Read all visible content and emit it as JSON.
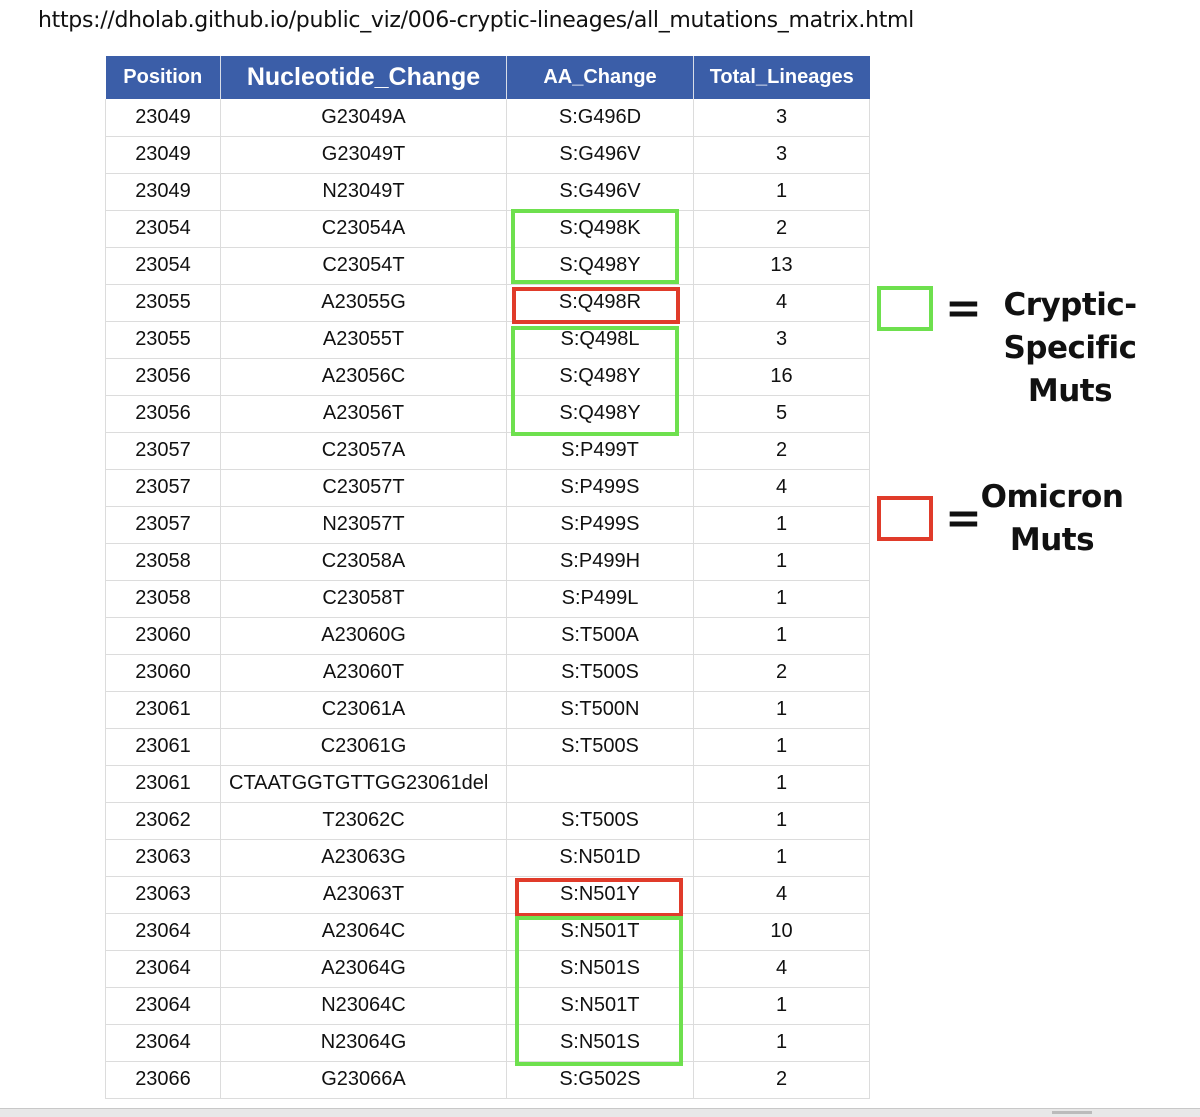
{
  "url": "https://dholab.github.io/public_viz/006-cryptic-lineages/all_mutations_matrix.html",
  "table": {
    "headers": [
      "Position",
      "Nucleotide_Change",
      "AA_Change",
      "Total_Lineages"
    ],
    "header_color": "#3b5ea8",
    "rows": [
      [
        "23049",
        "G23049A",
        "S:G496D",
        "3"
      ],
      [
        "23049",
        "G23049T",
        "S:G496V",
        "3"
      ],
      [
        "23049",
        "N23049T",
        "S:G496V",
        "1"
      ],
      [
        "23054",
        "C23054A",
        "S:Q498K",
        "2"
      ],
      [
        "23054",
        "C23054T",
        "S:Q498Y",
        "13"
      ],
      [
        "23055",
        "A23055G",
        "S:Q498R",
        "4"
      ],
      [
        "23055",
        "A23055T",
        "S:Q498L",
        "3"
      ],
      [
        "23056",
        "A23056C",
        "S:Q498Y",
        "16"
      ],
      [
        "23056",
        "A23056T",
        "S:Q498Y",
        "5"
      ],
      [
        "23057",
        "C23057A",
        "S:P499T",
        "2"
      ],
      [
        "23057",
        "C23057T",
        "S:P499S",
        "4"
      ],
      [
        "23057",
        "N23057T",
        "S:P499S",
        "1"
      ],
      [
        "23058",
        "C23058A",
        "S:P499H",
        "1"
      ],
      [
        "23058",
        "C23058T",
        "S:P499L",
        "1"
      ],
      [
        "23060",
        "A23060G",
        "S:T500A",
        "1"
      ],
      [
        "23060",
        "A23060T",
        "S:T500S",
        "2"
      ],
      [
        "23061",
        "C23061A",
        "S:T500N",
        "1"
      ],
      [
        "23061",
        "C23061G",
        "S:T500S",
        "1"
      ],
      [
        "23061",
        "CTAATGGTGTTGG23061del",
        "",
        "1"
      ],
      [
        "23062",
        "T23062C",
        "S:T500S",
        "1"
      ],
      [
        "23063",
        "A23063G",
        "S:N501D",
        "1"
      ],
      [
        "23063",
        "A23063T",
        "S:N501Y",
        "4"
      ],
      [
        "23064",
        "A23064C",
        "S:N501T",
        "10"
      ],
      [
        "23064",
        "A23064G",
        "S:N501S",
        "4"
      ],
      [
        "23064",
        "N23064C",
        "S:N501T",
        "1"
      ],
      [
        "23064",
        "N23064G",
        "S:N501S",
        "1"
      ],
      [
        "23066",
        "G23066A",
        "S:G502S",
        "2"
      ]
    ]
  },
  "legend": {
    "cryptic": {
      "symbol": "=",
      "line1": "Cryptic-",
      "line2": "Specific Muts",
      "color": "#6ee04e"
    },
    "omicron": {
      "symbol": "=",
      "line1": "Omicron",
      "line2": "Muts",
      "color": "#e03b2a"
    }
  }
}
